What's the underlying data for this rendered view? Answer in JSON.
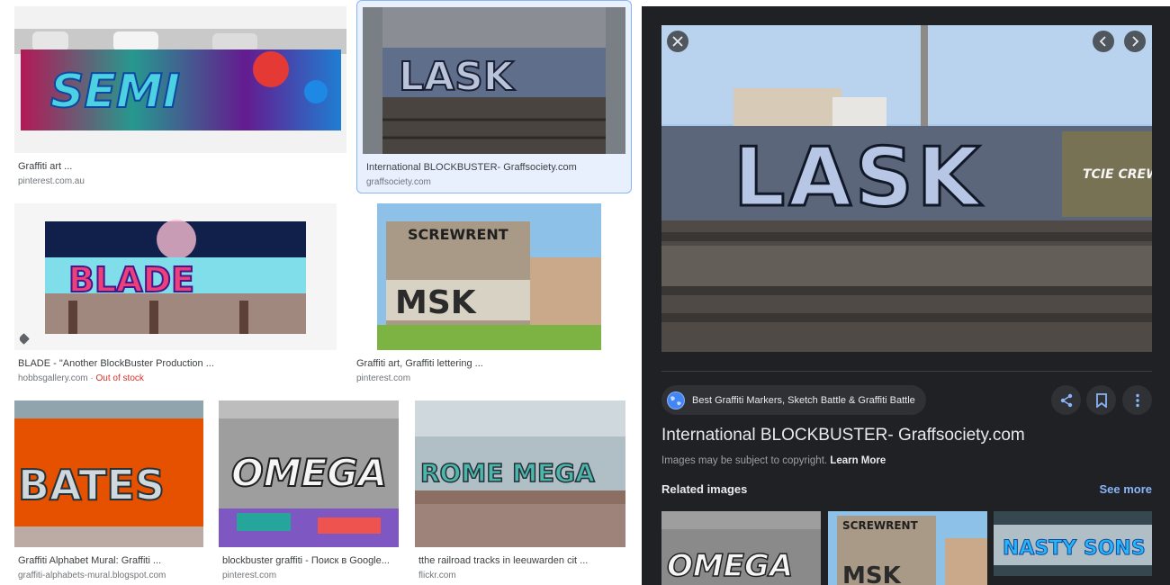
{
  "results": [
    {
      "caption": "Graffiti art ...",
      "source": "pinterest.com.au",
      "art": "SEMI"
    },
    {
      "caption": "International BLOCKBUSTER- Graffsociety.com",
      "source": "graffsociety.com",
      "art": "LASK",
      "selected": true
    },
    {
      "caption": "BLADE - \"Another BlockBuster Production ...",
      "source": "hobbsgallery.com",
      "source_extra": "Out of stock",
      "art": "BLADE"
    },
    {
      "caption": "Graffiti art, Graffiti lettering ...",
      "source": "pinterest.com",
      "art": "SCREWRENT"
    },
    {
      "caption": "Graffiti Alphabet Mural: Graffiti ...",
      "source": "graffiti-alphabets-mural.blogspot.com",
      "art": "BATES"
    },
    {
      "caption": "blockbuster graffiti - Поиск в Google...",
      "source": "pinterest.com",
      "art": "OMEGA"
    },
    {
      "caption": "tthe railroad tracks in leeuwarden cit ...",
      "source": "flickr.com",
      "art": "ROME MEGA"
    }
  ],
  "viewer": {
    "source_name": "Best Graffiti Markers, Sketch Battle & Graffiti Battle",
    "title": "International BLOCKBUSTER- Graffsociety.com",
    "copyright_text": "Images may be subject to copyright.",
    "learn_more": "Learn More",
    "related_label": "Related images",
    "see_more": "See more",
    "related": [
      {
        "art": "OMEGA"
      },
      {
        "art": "SCREWRENT"
      },
      {
        "art": "NASTY SONS"
      }
    ],
    "main_art": "LASK",
    "main_art_sub": "TCIE CREW"
  },
  "icons": [
    "close-icon",
    "chevron-left-icon",
    "chevron-right-icon",
    "globe-icon",
    "share-icon",
    "bookmark-icon",
    "more-vert-icon",
    "tag-icon"
  ],
  "colors": {
    "panel_bg": "#202124",
    "link": "#8ab4f8",
    "out_of_stock": "#d93025",
    "selected_bg": "#e8f0fe"
  }
}
